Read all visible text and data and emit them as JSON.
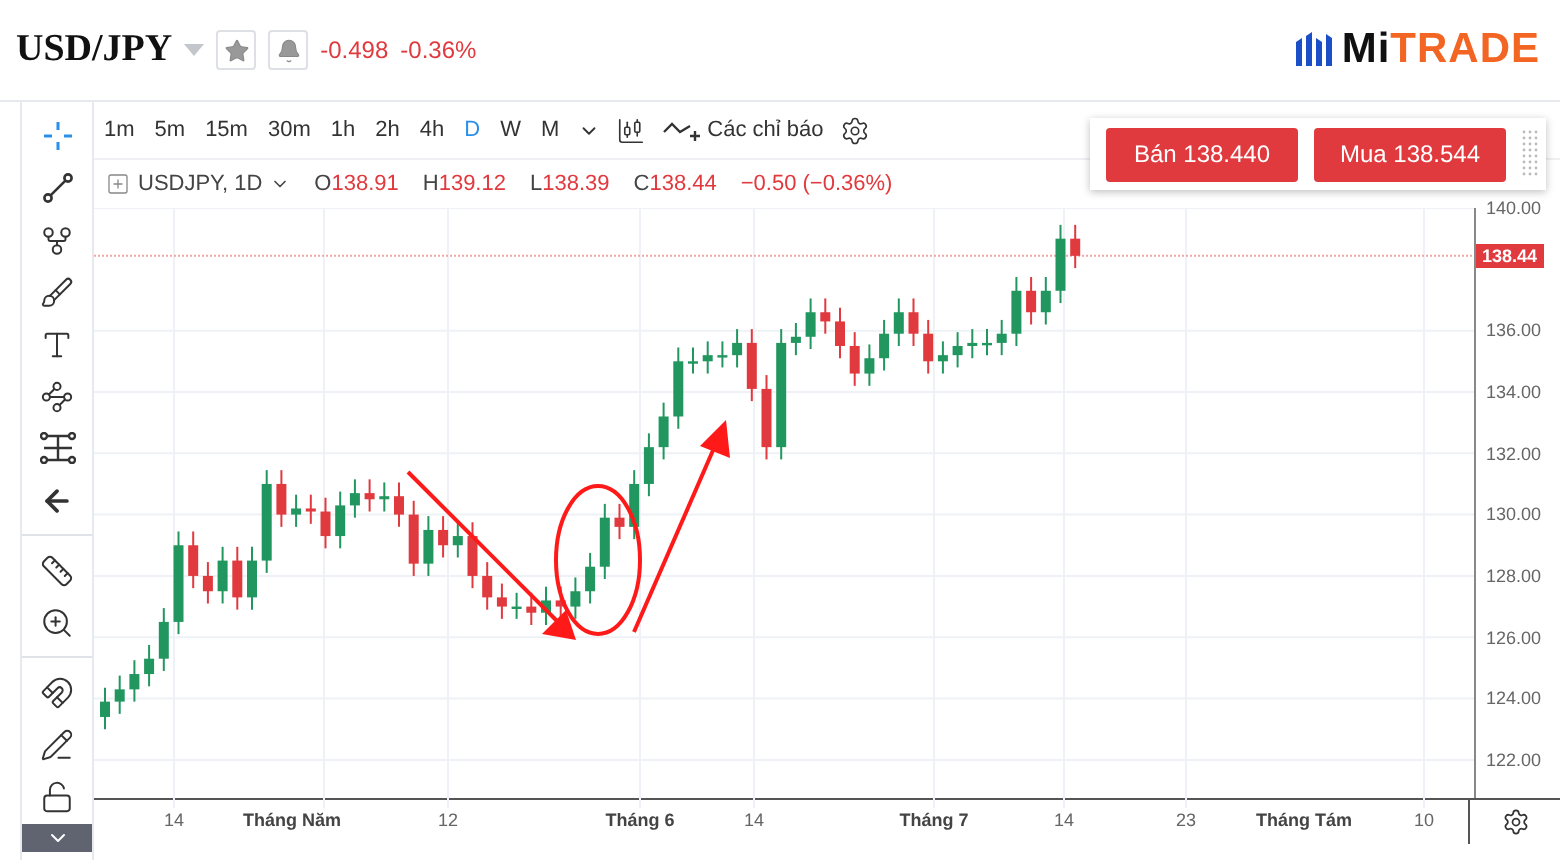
{
  "header": {
    "symbol": "USD/JPY",
    "change": "-0.498",
    "change_percent": "-0.36%"
  },
  "logo": {
    "part_1": "Mi",
    "part_2": "TRADE"
  },
  "toolbar": {
    "intervals": [
      {
        "label": "1m",
        "selected": false
      },
      {
        "label": "5m",
        "selected": false
      },
      {
        "label": "15m",
        "selected": false
      },
      {
        "label": "30m",
        "selected": false
      },
      {
        "label": "1h",
        "selected": false
      },
      {
        "label": "2h",
        "selected": false
      },
      {
        "label": "4h",
        "selected": false
      },
      {
        "label": "D",
        "selected": true
      },
      {
        "label": "W",
        "selected": false
      },
      {
        "label": "M",
        "selected": false
      }
    ],
    "indicators": "Các chỉ báo"
  },
  "drawing_tools": [
    {
      "kind": "crosshair",
      "selected": true
    },
    {
      "kind": "trendline",
      "selected": false
    },
    {
      "kind": "fork",
      "selected": false
    },
    {
      "kind": "brush",
      "selected": false
    },
    {
      "kind": "text",
      "selected": false
    },
    {
      "kind": "pattern",
      "selected": false
    },
    {
      "kind": "levels",
      "selected": false
    },
    {
      "kind": "back",
      "selected": false
    },
    {
      "kind": "ruler",
      "selected": false
    },
    {
      "kind": "zoom",
      "selected": false
    },
    {
      "kind": "magnet",
      "selected": false
    },
    {
      "kind": "lock-drawing",
      "selected": false
    },
    {
      "kind": "lock",
      "selected": false
    }
  ],
  "legend": {
    "symbol": "USDJPY, 1D",
    "values": [
      {
        "prefix": "O",
        "value": "138.91"
      },
      {
        "prefix": "H",
        "value": "139.12"
      },
      {
        "prefix": "L",
        "value": "138.39"
      },
      {
        "prefix": "C",
        "value": "138.44"
      }
    ],
    "change": "−0.50 (−0.36%)"
  },
  "trade": {
    "sell": "Bán 138.440",
    "buy": "Mua 138.544"
  },
  "price_axis": {
    "ticks": [
      "140.00",
      "136.00",
      "134.00",
      "132.00",
      "130.00",
      "128.00",
      "126.00",
      "124.00",
      "122.00"
    ],
    "last_price": "138.44"
  },
  "time_axis": {
    "labels": [
      {
        "text": "14",
        "kind": "day"
      },
      {
        "text": "Tháng Năm",
        "kind": "month"
      },
      {
        "text": "12",
        "kind": "day"
      },
      {
        "text": "Tháng 6",
        "kind": "month"
      },
      {
        "text": "14",
        "kind": "day"
      },
      {
        "text": "Tháng 7",
        "kind": "month"
      },
      {
        "text": "14",
        "kind": "day"
      },
      {
        "text": "23",
        "kind": "day"
      },
      {
        "text": "Tháng Tám",
        "kind": "month"
      },
      {
        "text": "10",
        "kind": "day"
      }
    ]
  }
}
